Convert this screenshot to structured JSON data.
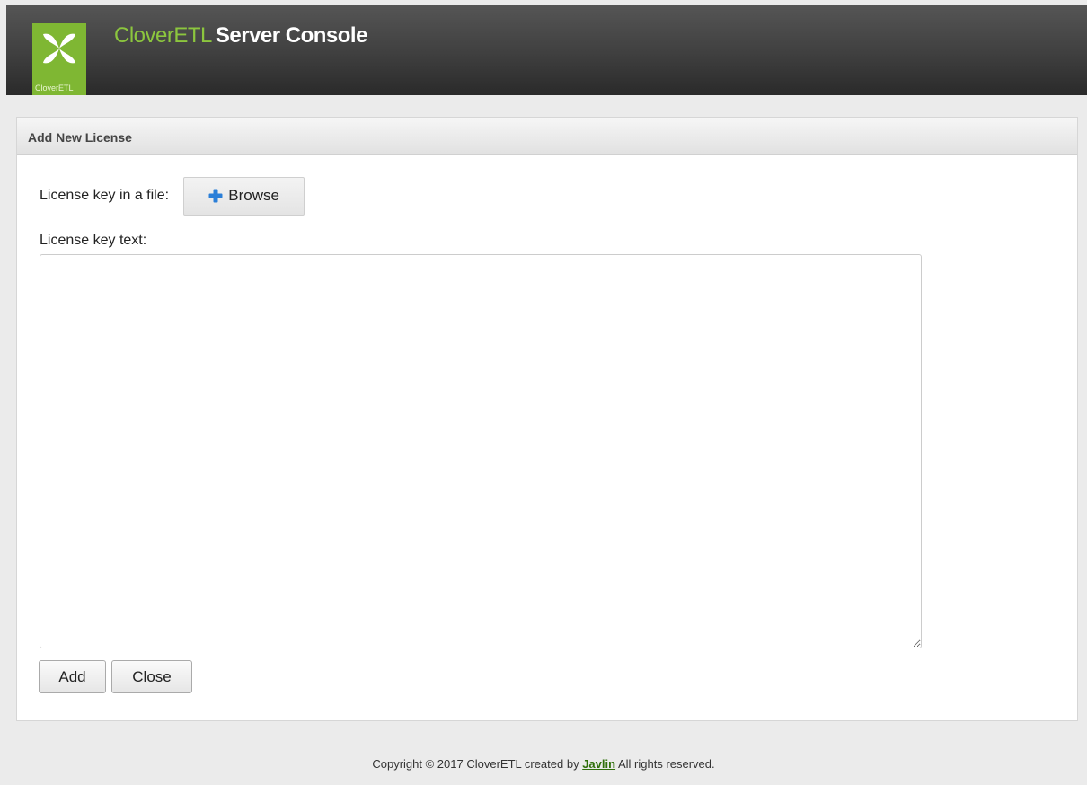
{
  "header": {
    "logo_icon": "clover-logo-icon",
    "logo_text": "CloverETL",
    "brand_part1": "CloverETL",
    "brand_part2": "Server Console"
  },
  "panel": {
    "title": "Add New License",
    "file_label": "License key in a file:",
    "browse_label": "Browse",
    "browse_icon": "plus-icon",
    "text_label": "License key text:",
    "license_text_value": "",
    "add_label": "Add",
    "close_label": "Close"
  },
  "footer": {
    "prefix": "Copyright © 2017 CloverETL created by",
    "link_text": "Javlin",
    "suffix": "All rights reserved."
  },
  "colors": {
    "brand_green": "#8cc63e",
    "logo_bg": "#7fb733",
    "link_green": "#2f6f0a",
    "plus_blue": "#2b7fd8"
  }
}
